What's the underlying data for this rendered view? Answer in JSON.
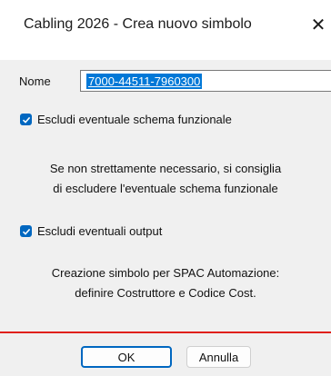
{
  "window": {
    "title": "Cabling 2026 - Crea nuovo simbolo",
    "close_glyph": "✕"
  },
  "form": {
    "name_label": "Nome",
    "name_value": "7000-44511-7960300"
  },
  "options": {
    "exclude_schema_label": "Escludi eventuale schema funzionale",
    "exclude_schema_checked": true,
    "exclude_schema_note_line1": "Se non strettamente necessario, si consiglia",
    "exclude_schema_note_line2": "di escludere l'eventuale schema funzionale",
    "exclude_output_label": "Escludi eventuali output",
    "exclude_output_checked": true
  },
  "info": {
    "line1": "Creazione simbolo per SPAC Automazione:",
    "line2": "definire Costruttore e Codice Cost."
  },
  "buttons": {
    "ok": "OK",
    "cancel": "Annulla"
  },
  "colors": {
    "accent": "#0067c0",
    "selection": "#0078d7",
    "red_rule": "#e0201b"
  }
}
